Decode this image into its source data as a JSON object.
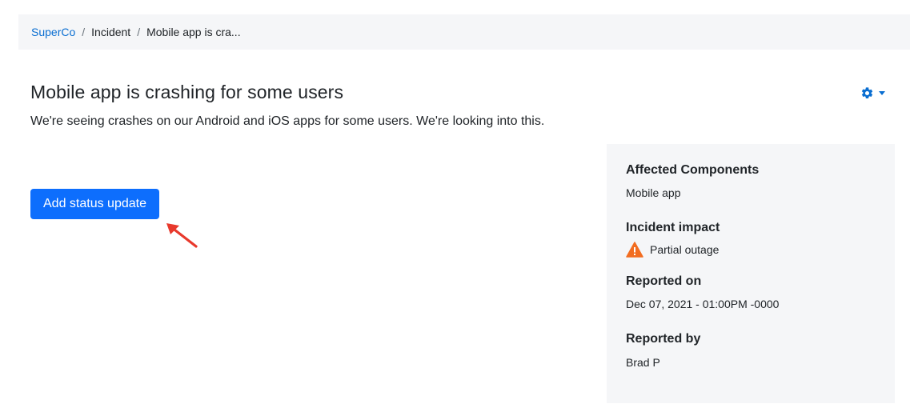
{
  "breadcrumb": {
    "root": "SuperCo",
    "separator": "/",
    "section": "Incident",
    "current": "Mobile app is cra..."
  },
  "incident": {
    "title": "Mobile app is crashing for some users",
    "description": "We're seeing crashes on our Android and iOS apps for some users. We're looking into this."
  },
  "actions": {
    "add_status_update": "Add status update"
  },
  "details": {
    "affected_components_label": "Affected Components",
    "affected_components_value": "Mobile app",
    "impact_label": "Incident impact",
    "impact_value": "Partial outage",
    "reported_on_label": "Reported on",
    "reported_on_value": "Dec 07, 2021 - 01:00PM -0000",
    "reported_by_label": "Reported by",
    "reported_by_value": "Brad P"
  },
  "icons": {
    "settings": "gear-icon",
    "dropdown": "caret-down-icon",
    "impact": "warning-icon",
    "annotation": "red-arrow-icon"
  },
  "colors": {
    "link": "#0a6ed1",
    "primary_button": "#0d6efd",
    "warning": "#f26d21",
    "annotation_arrow": "#e8392c",
    "panel_bg": "#f5f6f8"
  }
}
